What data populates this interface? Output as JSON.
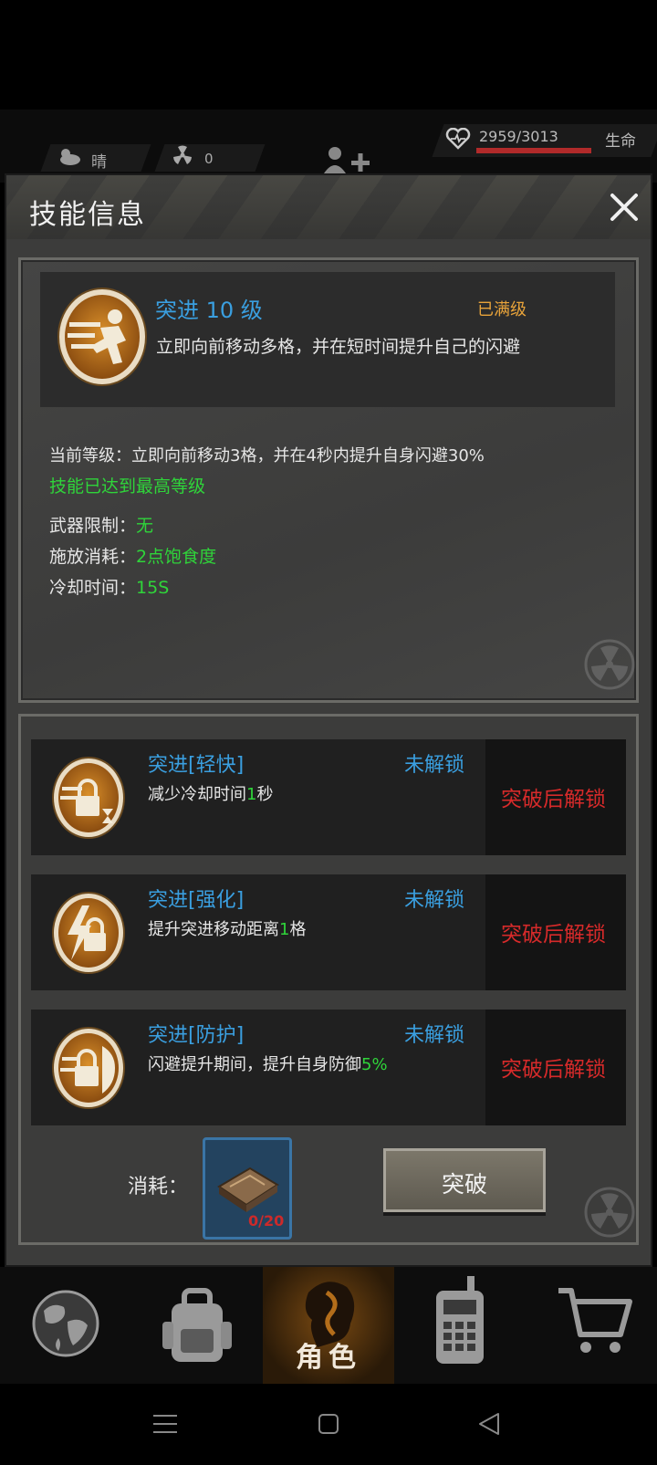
{
  "status": {
    "weather": "晴",
    "radiation": "0",
    "hp": "2959/3013",
    "hp_fraction": 0.982,
    "hp_label": "生命"
  },
  "modal": {
    "title": "技能信息"
  },
  "skill": {
    "name": "突进 10 级",
    "maxed": "已满级",
    "description": "立即向前移动多格，并在短时间提升自己的闪避",
    "current_level": "当前等级：立即向前移动3格，并在4秒内提升自身闪避30%",
    "max_note": "技能已达到最高等级",
    "weapon_label": "武器限制：",
    "weapon_value": "无",
    "cost_label": "施放消耗：",
    "cost_value": "2点饱食度",
    "cooldown_label": "冷却时间：",
    "cooldown_value": "15S"
  },
  "talents": [
    {
      "name": "突进[轻快]",
      "state": "未解锁",
      "desc_pre": "减少冷却时间",
      "desc_value": "1",
      "desc_post": "秒",
      "unlock": "突破后解锁"
    },
    {
      "name": "突进[强化]",
      "state": "未解锁",
      "desc_pre": "提升突进移动距离",
      "desc_value": "1",
      "desc_post": "格",
      "unlock": "突破后解锁"
    },
    {
      "name": "突进[防护]",
      "state": "未解锁",
      "desc_pre": "闪避提升期间，提升自身防御",
      "desc_value": "5%",
      "desc_post": "",
      "unlock": "突破后解锁"
    }
  ],
  "breakthrough": {
    "cost_label": "消耗：",
    "item_count": "0/20",
    "button_label": "突破"
  },
  "tabs": {
    "character_label": "角色"
  },
  "colors": {
    "accent_blue": "#3a9fe0",
    "green": "#2fd43a",
    "red": "#d62a2a",
    "orange": "#e8a33a"
  }
}
